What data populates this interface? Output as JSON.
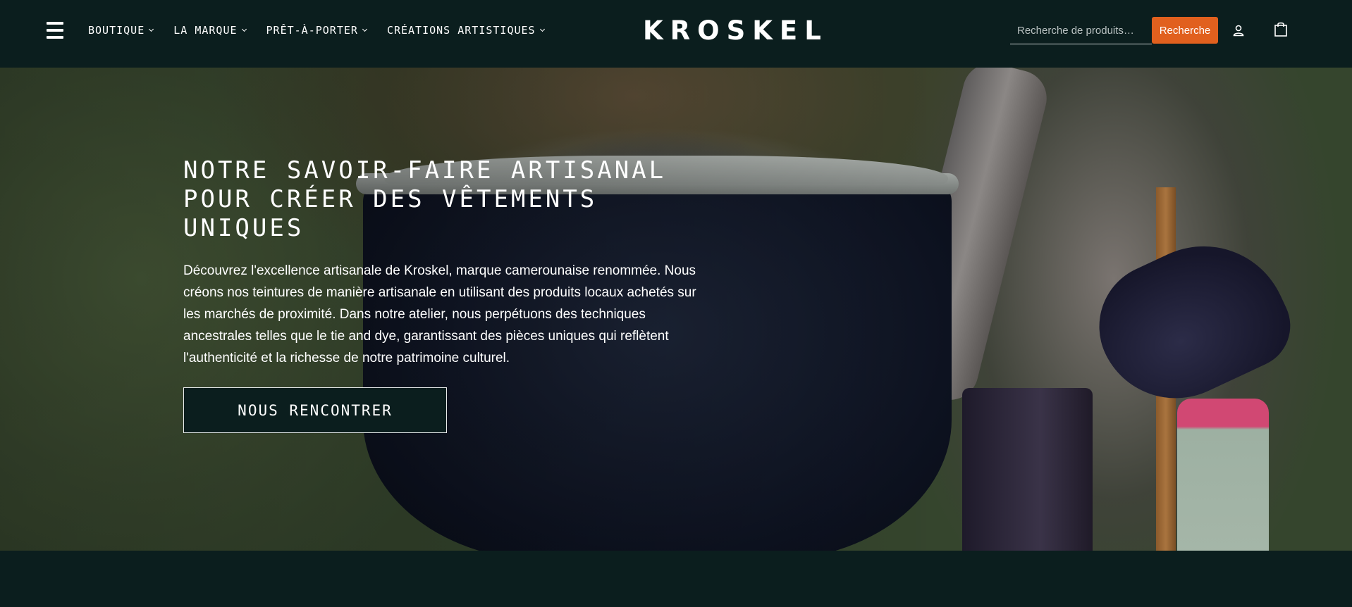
{
  "header": {
    "menu_icon": "hamburger-menu-icon",
    "nav": [
      {
        "label": "BOUTIQUE"
      },
      {
        "label": "LA MARQUE"
      },
      {
        "label": "PRÊT-À-PORTER"
      },
      {
        "label": "CRÉATIONS ARTISTIQUES"
      }
    ],
    "logo_text": "KROSKEL",
    "search": {
      "placeholder": "Recherche de produits…",
      "value": "",
      "button_label": "Recherche"
    },
    "account_icon": "user-icon",
    "cart_icon": "shopping-bag-icon"
  },
  "hero": {
    "title": "Notre savoir-faire artisanal pour créer des vêtements uniques",
    "text": "Découvrez l'excellence artisanale de Kroskel, marque camerounaise renommée. Nous créons nos teintures de manière artisanale en utilisant des produits locaux achetés sur les marchés de proximité. Dans notre atelier, nous perpétuons des techniques ancestrales telles que le tie and dye, garantissant des pièces uniques qui reflètent l'authenticité et la richesse de notre patrimoine culturel.",
    "cta_label": "NOUS RENCONTRER"
  },
  "colors": {
    "background": "#0b1e1e",
    "accent": "#e1601e",
    "text": "#ffffff"
  }
}
